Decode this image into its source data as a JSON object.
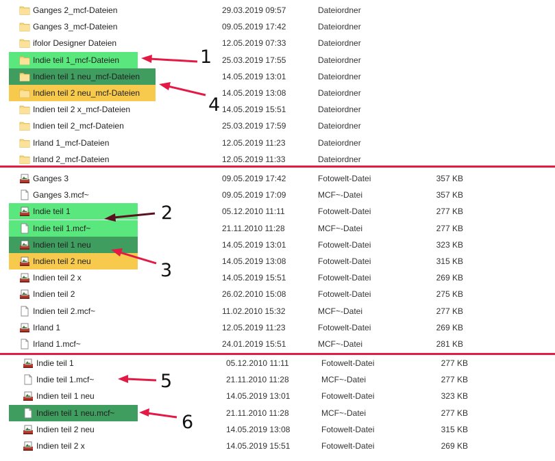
{
  "colors": {
    "highlight_light_green": "#5ae87e",
    "highlight_dark_green": "#3f9d5f",
    "highlight_yellow": "#f7c94c",
    "separator": "#e21a45",
    "arrow": "#e21a45"
  },
  "folder_section": [
    {
      "name": "Ganges 2_mcf-Dateien",
      "date": "29.03.2019 09:57",
      "type": "Dateiordner",
      "icon": "folder-icon",
      "hl": ""
    },
    {
      "name": "Ganges 3_mcf-Dateien",
      "date": "09.05.2019 17:42",
      "type": "Dateiordner",
      "icon": "folder-icon",
      "hl": ""
    },
    {
      "name": "ifolor Designer Dateien",
      "date": "12.05.2019 07:33",
      "type": "Dateiordner",
      "icon": "folder-icon",
      "hl": ""
    },
    {
      "name": "Indie teil 1_mcf-Dateien",
      "date": "25.03.2019 17:55",
      "type": "Dateiordner",
      "icon": "folder-icon",
      "hl": "light_green"
    },
    {
      "name": "Indien teil 1 neu_mcf-Dateien",
      "date": "14.05.2019 13:01",
      "type": "Dateiordner",
      "icon": "folder-icon",
      "hl": "dark_green"
    },
    {
      "name": "Indien teil 2 neu_mcf-Dateien",
      "date": "14.05.2019 13:08",
      "type": "Dateiordner",
      "icon": "folder-icon",
      "hl": "yellow"
    },
    {
      "name": "Indien teil 2 x_mcf-Dateien",
      "date": "14.05.2019 15:51",
      "type": "Dateiordner",
      "icon": "folder-icon",
      "hl": ""
    },
    {
      "name": "Indien teil 2_mcf-Dateien",
      "date": "25.03.2019 17:59",
      "type": "Dateiordner",
      "icon": "folder-icon",
      "hl": ""
    },
    {
      "name": "Irland 1_mcf-Dateien",
      "date": "12.05.2019 11:23",
      "type": "Dateiordner",
      "icon": "folder-icon",
      "hl": ""
    },
    {
      "name": "Irland 2_mcf-Dateien",
      "date": "12.05.2019 11:33",
      "type": "Dateiordner",
      "icon": "folder-icon",
      "hl": ""
    }
  ],
  "file_section": [
    {
      "name": "Ganges 3",
      "date": "09.05.2019 17:42",
      "type": "Fotowelt-Datei",
      "size": "357 KB",
      "icon": "fotowelt-file-icon",
      "hl": ""
    },
    {
      "name": "Ganges 3.mcf~",
      "date": "09.05.2019 17:09",
      "type": "MCF~-Datei",
      "size": "357 KB",
      "icon": "blank-file-icon",
      "hl": ""
    },
    {
      "name": "Indie teil 1",
      "date": "05.12.2010 11:11",
      "type": "Fotowelt-Datei",
      "size": "277 KB",
      "icon": "fotowelt-file-icon",
      "hl": "light_green"
    },
    {
      "name": "Indie teil 1.mcf~",
      "date": "21.11.2010 11:28",
      "type": "MCF~-Datei",
      "size": "277 KB",
      "icon": "blank-file-icon",
      "hl": "light_green"
    },
    {
      "name": "Indien teil 1 neu",
      "date": "14.05.2019 13:01",
      "type": "Fotowelt-Datei",
      "size": "323 KB",
      "icon": "fotowelt-file-icon",
      "hl": "dark_green"
    },
    {
      "name": "Indien teil 2 neu",
      "date": "14.05.2019 13:08",
      "type": "Fotowelt-Datei",
      "size": "315 KB",
      "icon": "fotowelt-file-icon",
      "hl": "yellow"
    },
    {
      "name": "Indien teil 2 x",
      "date": "14.05.2019 15:51",
      "type": "Fotowelt-Datei",
      "size": "269 KB",
      "icon": "fotowelt-file-icon",
      "hl": ""
    },
    {
      "name": "Indien teil 2",
      "date": "26.02.2010 15:08",
      "type": "Fotowelt-Datei",
      "size": "275 KB",
      "icon": "fotowelt-file-icon",
      "hl": ""
    },
    {
      "name": "Indien teil 2.mcf~",
      "date": "11.02.2010 15:32",
      "type": "MCF~-Datei",
      "size": "277 KB",
      "icon": "blank-file-icon",
      "hl": ""
    },
    {
      "name": "Irland 1",
      "date": "12.05.2019 11:23",
      "type": "Fotowelt-Datei",
      "size": "269 KB",
      "icon": "fotowelt-file-icon",
      "hl": ""
    },
    {
      "name": "Irland 1.mcf~",
      "date": "24.01.2019 15:51",
      "type": "MCF~-Datei",
      "size": "281 KB",
      "icon": "blank-file-icon",
      "hl": ""
    }
  ],
  "third_section": [
    {
      "name": "Indie teil 1",
      "date": "05.12.2010 11:11",
      "type": "Fotowelt-Datei",
      "size": "277 KB",
      "icon": "fotowelt-file-icon",
      "hl": ""
    },
    {
      "name": "Indie teil 1.mcf~",
      "date": "21.11.2010 11:28",
      "type": "MCF~-Datei",
      "size": "277 KB",
      "icon": "blank-file-icon",
      "hl": ""
    },
    {
      "name": "Indien teil 1 neu",
      "date": "14.05.2019 13:01",
      "type": "Fotowelt-Datei",
      "size": "323 KB",
      "icon": "fotowelt-file-icon",
      "hl": ""
    },
    {
      "name": "Indien teil 1 neu.mcf~",
      "date": "21.11.2010 11:28",
      "type": "MCF~-Datei",
      "size": "277 KB",
      "icon": "blank-file-icon",
      "hl": "dark_green"
    },
    {
      "name": "Indien teil 2 neu",
      "date": "14.05.2019 13:08",
      "type": "Fotowelt-Datei",
      "size": "315 KB",
      "icon": "fotowelt-file-icon",
      "hl": ""
    },
    {
      "name": "Indien teil 2 x",
      "date": "14.05.2019 15:51",
      "type": "Fotowelt-Datei",
      "size": "269 KB",
      "icon": "fotowelt-file-icon",
      "hl": ""
    }
  ],
  "annotations": {
    "n1": "1",
    "n2": "2",
    "n3": "3",
    "n4": "4",
    "n5": "5",
    "n6": "6"
  }
}
